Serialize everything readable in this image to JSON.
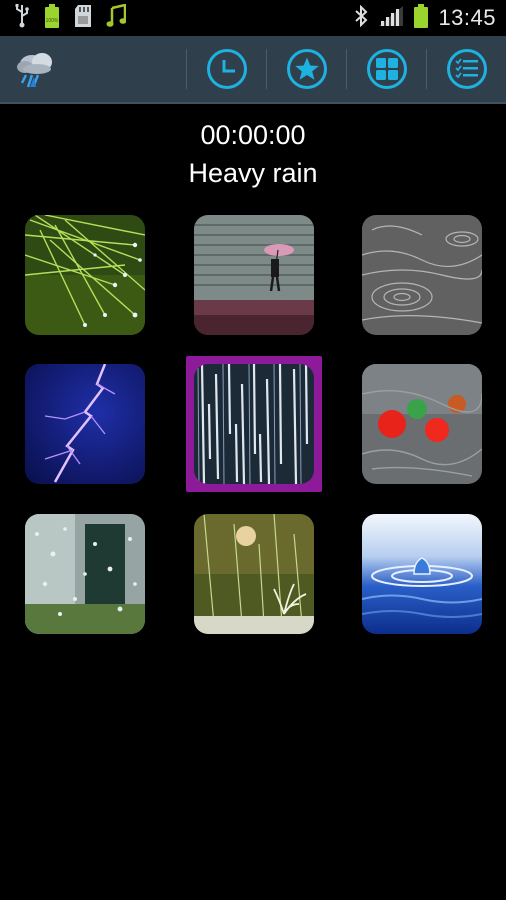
{
  "status_bar": {
    "time": "13:45",
    "left_icons": [
      "usb-icon",
      "battery-full-icon",
      "sd-card-icon",
      "music-note-icon"
    ],
    "right_icons": [
      "bluetooth-icon",
      "signal-icon",
      "battery-icon"
    ]
  },
  "action_bar": {
    "app_icon": "rain-cloud-icon",
    "actions": [
      {
        "name": "timer",
        "icon": "clock-icon"
      },
      {
        "name": "favorites",
        "icon": "star-icon"
      },
      {
        "name": "categories",
        "icon": "grid-icon"
      },
      {
        "name": "list",
        "icon": "checklist-icon"
      }
    ],
    "accent": "#1db2e0",
    "background": "#2f3f4c"
  },
  "player": {
    "timer": "00:00:00",
    "sound_name": "Heavy rain"
  },
  "sounds": [
    {
      "id": "rain-on-grass",
      "selected": false
    },
    {
      "id": "umbrella-street",
      "selected": false
    },
    {
      "id": "drops-on-water",
      "selected": false
    },
    {
      "id": "lightning",
      "selected": false
    },
    {
      "id": "heavy-rain",
      "selected": true
    },
    {
      "id": "rainy-window-lights",
      "selected": false
    },
    {
      "id": "rain-on-window",
      "selected": false
    },
    {
      "id": "rain-splash",
      "selected": false
    },
    {
      "id": "water-drop",
      "selected": false
    }
  ],
  "selection_color": "#8c1a99"
}
